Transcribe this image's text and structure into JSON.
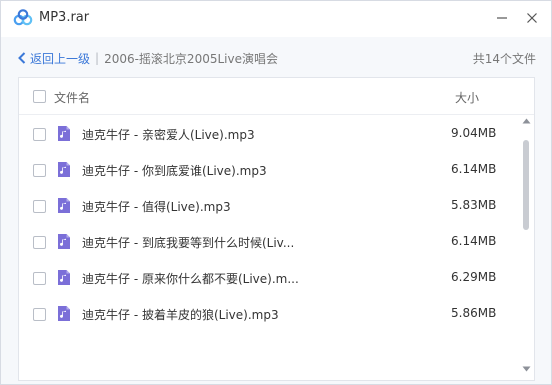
{
  "window": {
    "title": "MP3.rar",
    "logo_icon": "baidu-netdisk-cloud-icon",
    "accent_color": "#3b78d8"
  },
  "nav": {
    "back_label": "返回上一级",
    "separator": "|",
    "path": "2006-摇滚北京2005Live演唱会",
    "file_count": "共14个文件"
  },
  "list": {
    "header_name": "文件名",
    "header_size": "大小",
    "files": [
      {
        "name": "迪克牛仔 - 亲密爱人(Live).mp3",
        "size": "9.04MB",
        "icon": "music-file-icon"
      },
      {
        "name": "迪克牛仔 - 你到底爱谁(Live).mp3",
        "size": "6.14MB",
        "icon": "music-file-icon"
      },
      {
        "name": "迪克牛仔 - 值得(Live).mp3",
        "size": "5.83MB",
        "icon": "music-file-icon"
      },
      {
        "name": "迪克牛仔 - 到底我要等到什么时候(Liv...",
        "size": "6.14MB",
        "icon": "music-file-icon"
      },
      {
        "name": "迪克牛仔 - 原来你什么都不要(Live).m...",
        "size": "6.29MB",
        "icon": "music-file-icon"
      },
      {
        "name": "迪克牛仔 - 披着羊皮的狼(Live).mp3",
        "size": "5.86MB",
        "icon": "music-file-icon"
      }
    ]
  }
}
